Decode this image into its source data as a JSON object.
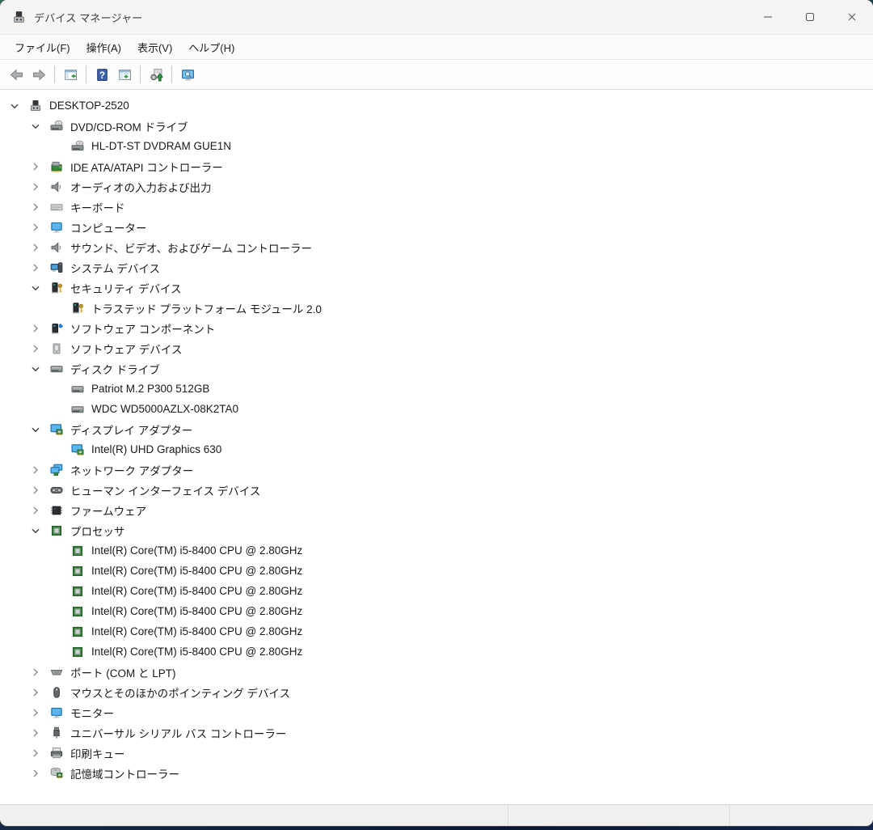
{
  "window": {
    "title": "デバイス マネージャー",
    "app_icon": "computer",
    "controls": [
      {
        "name": "minimize",
        "icon": "minimize"
      },
      {
        "name": "maximize",
        "icon": "maximize"
      },
      {
        "name": "close",
        "icon": "close"
      }
    ]
  },
  "menu": {
    "items": [
      {
        "name": "file",
        "label": "ファイル(F)"
      },
      {
        "name": "action",
        "label": "操作(A)"
      },
      {
        "name": "view",
        "label": "表示(V)"
      },
      {
        "name": "help",
        "label": "ヘルプ(H)"
      }
    ]
  },
  "toolbar": {
    "groups": [
      [
        {
          "name": "back",
          "icon": "arrow-left"
        },
        {
          "name": "forward",
          "icon": "arrow-right"
        }
      ],
      [
        {
          "name": "show-console-tree",
          "icon": "panel-arrow-left"
        }
      ],
      [
        {
          "name": "help",
          "icon": "help-badge"
        },
        {
          "name": "properties",
          "icon": "panel-arrow-right"
        }
      ],
      [
        {
          "name": "scan-hardware-changes",
          "icon": "scan-hardware"
        }
      ],
      [
        {
          "name": "search-devices",
          "icon": "monitor-magnifier"
        }
      ]
    ]
  },
  "tree": {
    "items": [
      {
        "level": 0,
        "state": "expanded",
        "icon": "computer",
        "label": "DESKTOP-2520"
      },
      {
        "level": 1,
        "state": "expanded",
        "icon": "dvd-drive",
        "label": "DVD/CD-ROM ドライブ"
      },
      {
        "level": 2,
        "state": "none",
        "icon": "dvd-drive",
        "label": "HL-DT-ST DVDRAM GUE1N"
      },
      {
        "level": 1,
        "state": "collapsed",
        "icon": "ide-controller",
        "label": "IDE ATA/ATAPI コントローラー"
      },
      {
        "level": 1,
        "state": "collapsed",
        "icon": "speaker",
        "label": "オーディオの入力および出力"
      },
      {
        "level": 1,
        "state": "collapsed",
        "icon": "keyboard",
        "label": "キーボード"
      },
      {
        "level": 1,
        "state": "collapsed",
        "icon": "monitor",
        "label": "コンピューター"
      },
      {
        "level": 1,
        "state": "collapsed",
        "icon": "speaker",
        "label": "サウンド、ビデオ、およびゲーム コントローラー"
      },
      {
        "level": 1,
        "state": "collapsed",
        "icon": "system-device",
        "label": "システム デバイス"
      },
      {
        "level": 1,
        "state": "expanded",
        "icon": "security-device",
        "label": "セキュリティ デバイス"
      },
      {
        "level": 2,
        "state": "none",
        "icon": "security-device",
        "label": "トラステッド プラットフォーム モジュール 2.0"
      },
      {
        "level": 1,
        "state": "collapsed",
        "icon": "software-component",
        "label": "ソフトウェア コンポーネント"
      },
      {
        "level": 1,
        "state": "collapsed",
        "icon": "software-device",
        "label": "ソフトウェア デバイス"
      },
      {
        "level": 1,
        "state": "expanded",
        "icon": "disk-drive",
        "label": "ディスク ドライブ"
      },
      {
        "level": 2,
        "state": "none",
        "icon": "disk-drive",
        "label": "Patriot M.2 P300 512GB"
      },
      {
        "level": 2,
        "state": "none",
        "icon": "disk-drive",
        "label": "WDC WD5000AZLX-08K2TA0"
      },
      {
        "level": 1,
        "state": "expanded",
        "icon": "display-adapter",
        "label": "ディスプレイ アダプター"
      },
      {
        "level": 2,
        "state": "none",
        "icon": "display-adapter",
        "label": "Intel(R) UHD Graphics 630"
      },
      {
        "level": 1,
        "state": "collapsed",
        "icon": "network-adapter",
        "label": "ネットワーク アダプター"
      },
      {
        "level": 1,
        "state": "collapsed",
        "icon": "hid-device",
        "label": "ヒューマン インターフェイス デバイス"
      },
      {
        "level": 1,
        "state": "collapsed",
        "icon": "firmware-chip",
        "label": "ファームウェア"
      },
      {
        "level": 1,
        "state": "expanded",
        "icon": "processor",
        "label": "プロセッサ"
      },
      {
        "level": 2,
        "state": "none",
        "icon": "processor",
        "label": "Intel(R) Core(TM) i5-8400 CPU @ 2.80GHz"
      },
      {
        "level": 2,
        "state": "none",
        "icon": "processor",
        "label": "Intel(R) Core(TM) i5-8400 CPU @ 2.80GHz"
      },
      {
        "level": 2,
        "state": "none",
        "icon": "processor",
        "label": "Intel(R) Core(TM) i5-8400 CPU @ 2.80GHz"
      },
      {
        "level": 2,
        "state": "none",
        "icon": "processor",
        "label": "Intel(R) Core(TM) i5-8400 CPU @ 2.80GHz"
      },
      {
        "level": 2,
        "state": "none",
        "icon": "processor",
        "label": "Intel(R) Core(TM) i5-8400 CPU @ 2.80GHz"
      },
      {
        "level": 2,
        "state": "none",
        "icon": "processor",
        "label": "Intel(R) Core(TM) i5-8400 CPU @ 2.80GHz"
      },
      {
        "level": 1,
        "state": "collapsed",
        "icon": "serial-port",
        "label": "ポート (COM と LPT)"
      },
      {
        "level": 1,
        "state": "collapsed",
        "icon": "mouse",
        "label": "マウスとそのほかのポインティング デバイス"
      },
      {
        "level": 1,
        "state": "collapsed",
        "icon": "monitor",
        "label": "モニター"
      },
      {
        "level": 1,
        "state": "collapsed",
        "icon": "usb-plug",
        "label": "ユニバーサル シリアル バス コントローラー"
      },
      {
        "level": 1,
        "state": "collapsed",
        "icon": "printer",
        "label": "印刷キュー"
      },
      {
        "level": 1,
        "state": "collapsed",
        "icon": "storage-controller",
        "label": "記憶域コントローラー"
      }
    ]
  },
  "statusbar": {
    "sections": [
      "",
      "",
      ""
    ]
  },
  "colors": {
    "monitor_blue": "#3da5e6",
    "chip_green": "#3c8b41",
    "key_gold": "#d9a733",
    "toolbar_arrow_green": "#2f9e3f",
    "help_blue": "#3b5fae"
  }
}
